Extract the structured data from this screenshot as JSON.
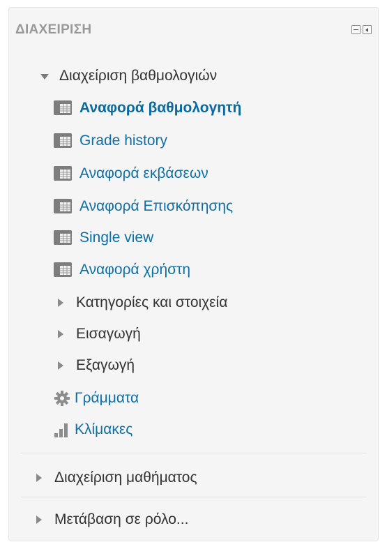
{
  "block": {
    "title": "ΔΙΑΧΕΙΡΙΣΗ"
  },
  "tree": {
    "grades_admin": {
      "label": "Διαχείριση βαθμολογιών",
      "reports": [
        {
          "label": "Αναφορά βαθμολογητή",
          "active": true
        },
        {
          "label": "Grade history",
          "active": false
        },
        {
          "label": "Αναφορά εκβάσεων",
          "active": false
        },
        {
          "label": "Αναφορά Επισκόπησης",
          "active": false
        },
        {
          "label": "Single view",
          "active": false
        },
        {
          "label": "Αναφορά χρήστη",
          "active": false
        }
      ],
      "categories_label": "Κατηγορίες και στοιχεία",
      "import_label": "Εισαγωγή",
      "export_label": "Εξαγωγή",
      "letters_label": "Γράμματα",
      "scales_label": "Κλίμακες"
    },
    "course_admin_label": "Διαχείριση μαθήματος",
    "switch_role_label": "Μετάβαση σε ρόλο..."
  },
  "colors": {
    "link": "#0f6fa5",
    "text": "#333333",
    "title": "#999999",
    "icon": "#8a8a8a"
  }
}
